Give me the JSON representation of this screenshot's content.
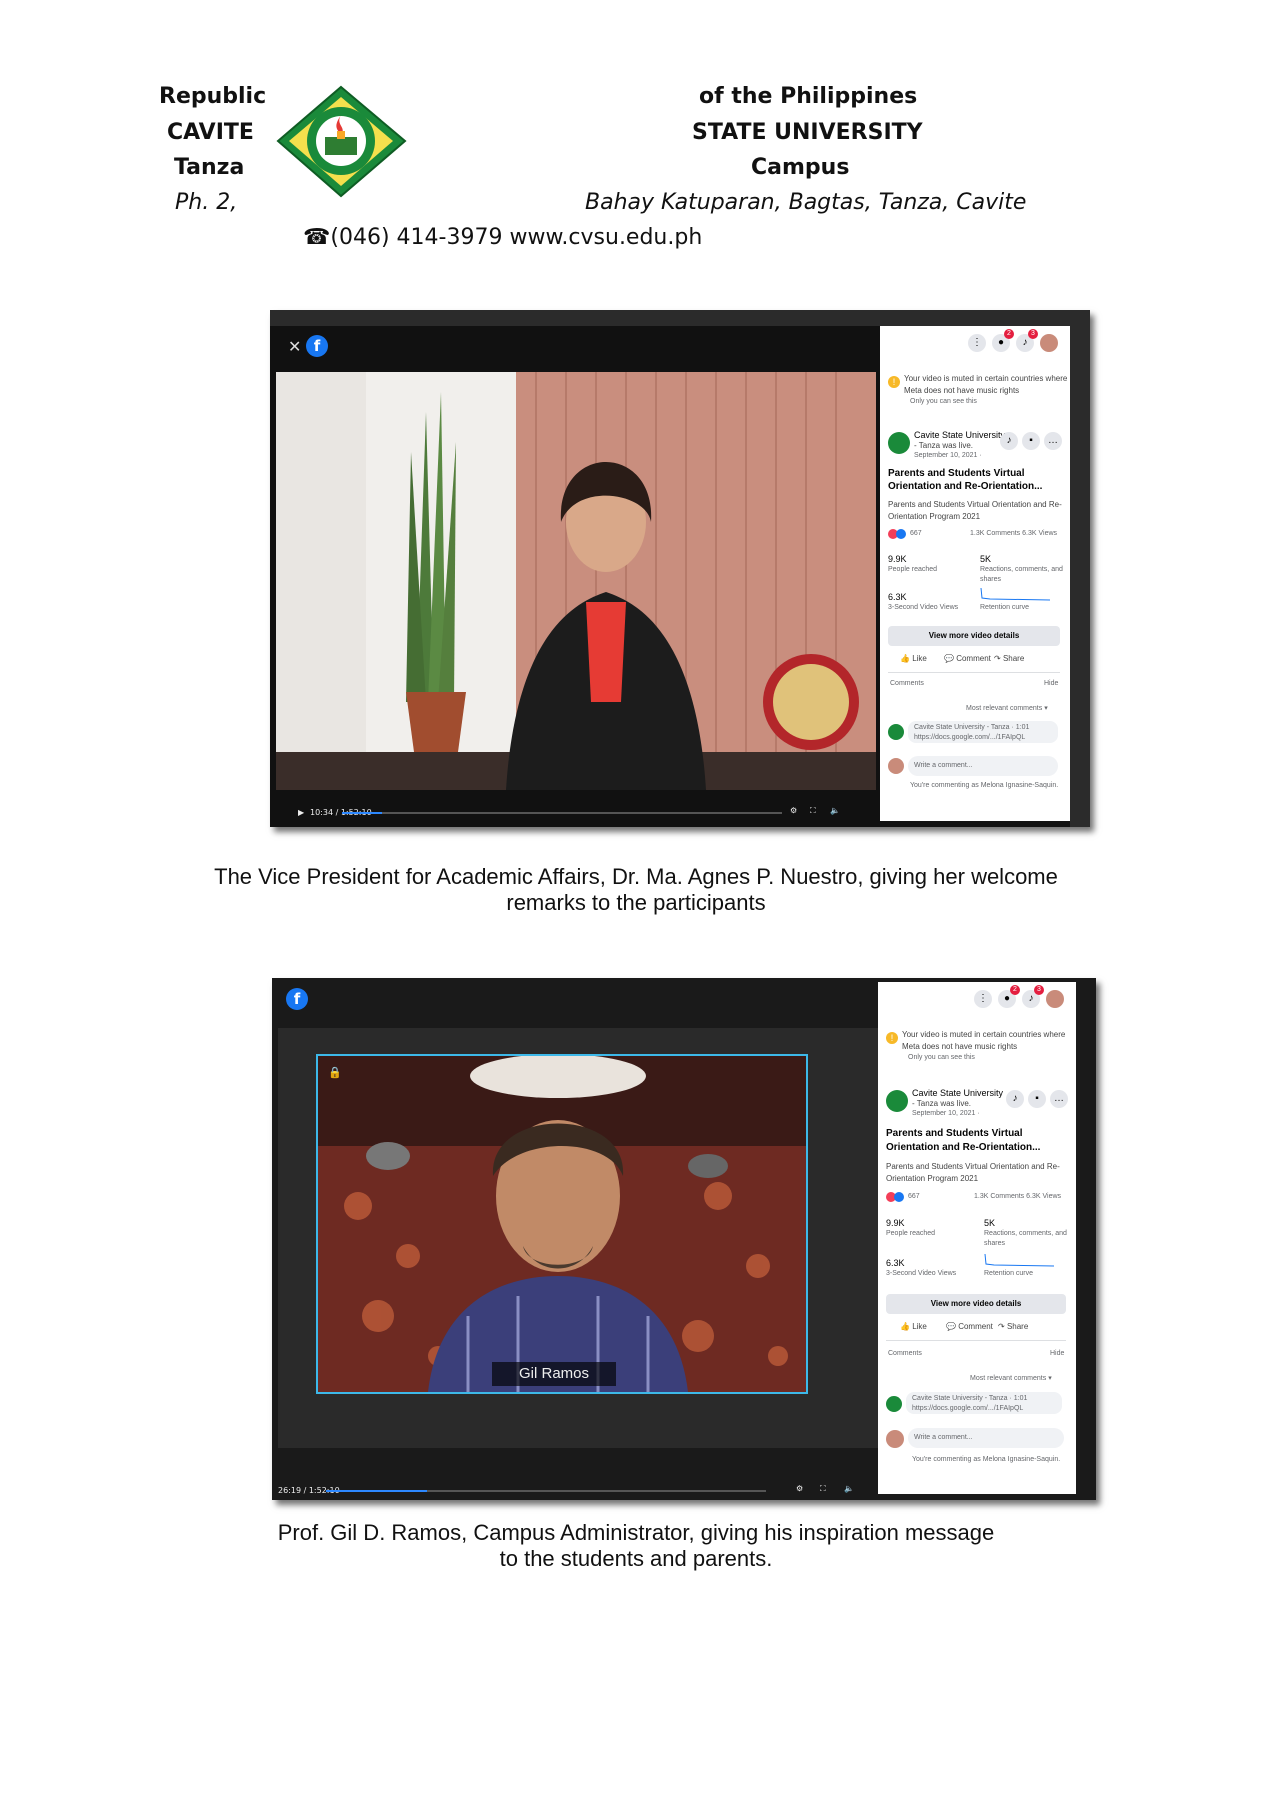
{
  "letterhead": {
    "left": [
      "Republic",
      "CAVITE",
      "Tanza",
      "Ph. 2,"
    ],
    "right": [
      "of the Philippines",
      "STATE UNIVERSITY",
      "Campus",
      "Bahay Katuparan, Bagtas, Tanza, Cavite"
    ],
    "contact": "☎(046) 414-3979 www.cvsu.edu.ph"
  },
  "fb_panel": {
    "muted_notice": "Your video is muted in certain countries where",
    "muted_notice2": "Meta does not have music rights",
    "only_you": "Only you can see this",
    "page_name": "Cavite State University",
    "page_name2": "- Tanza was live.",
    "date": "September 10, 2021 ·",
    "post_title": "Parents and Students Virtual",
    "post_title2": "Orientation and Re-Orientation...",
    "post_desc": "Parents and Students Virtual Orientation and Re-",
    "post_desc2": "Orientation Program 2021",
    "reactions": "667",
    "comments_views": "1.3K Comments  6.3K Views",
    "reached_value": "9.9K",
    "reached_label": "People reached",
    "engagement_value": "5K",
    "engagement_label": "Reactions, comments, and",
    "engagement_label2": "shares",
    "views_value": "6.3K",
    "views_label": "3-Second Video Views",
    "retention_label": "Retention curve",
    "view_more": "View more video details",
    "like": "Like",
    "comment": "Comment",
    "share": "Share",
    "comments_heading": "Comments",
    "hide": "Hide",
    "sort": "Most relevant comments ▾",
    "comment_author": "Cavite State University - Tanza · 1:01",
    "comment_link": "https://docs.google.com/.../1FAIpQL",
    "write_placeholder": "Write a comment...",
    "commenting_as": "You're commenting as Melona Ignasine-Saquin."
  },
  "shot1": {
    "time": "10:34 / 1:52:10",
    "progress": 0.09
  },
  "shot2": {
    "name_tag": "Gil Ramos",
    "time": "26:19 / 1:52:10",
    "progress": 0.23
  },
  "captions": {
    "first_line1": "The Vice President for Academic Affairs, Dr. Ma. Agnes P. Nuestro, giving her  welcome",
    "first_line2": "remarks to the participants",
    "second_line1": "Prof. Gil D. Ramos, Campus Administrator, giving his inspiration message",
    "second_line2": "to the students and parents."
  },
  "colors": {
    "fb_blue": "#1877f2",
    "logo_green": "#1a8a3a",
    "progress_blue": "#2d88ff"
  }
}
